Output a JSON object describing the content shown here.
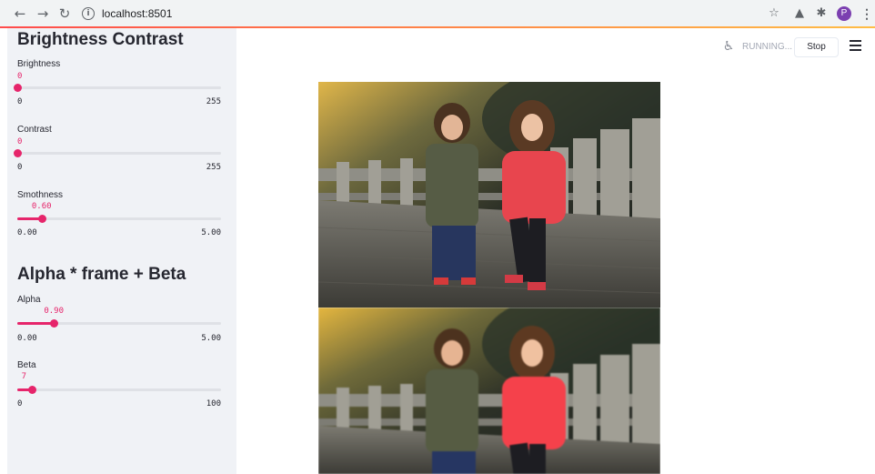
{
  "browser": {
    "url": "localhost:8501",
    "profile_initial": "P",
    "accent": "#ff4b4b",
    "profile_color": "#7b3fb0"
  },
  "sidebar": {
    "accent": "#e6256b",
    "section1_title": "Brightness Contrast",
    "section2_title": "Alpha * frame + Beta",
    "sliders": [
      {
        "label": "Brightness",
        "value": "0",
        "min": "0",
        "max": "255",
        "fraction": 0.0
      },
      {
        "label": "Contrast",
        "value": "0",
        "min": "0",
        "max": "255",
        "fraction": 0.0
      },
      {
        "label": "Smothness",
        "value": "0.60",
        "min": "0.00",
        "max": "5.00",
        "fraction": 0.12
      },
      {
        "label": "Alpha",
        "value": "0.90",
        "min": "0.00",
        "max": "5.00",
        "fraction": 0.18
      },
      {
        "label": "Beta",
        "value": "7",
        "min": "0",
        "max": "100",
        "fraction": 0.07
      }
    ]
  },
  "status": {
    "running_label": "RUNNING...",
    "stop_label": "Stop"
  },
  "main": {
    "images": [
      "original-image",
      "processed-image"
    ]
  }
}
